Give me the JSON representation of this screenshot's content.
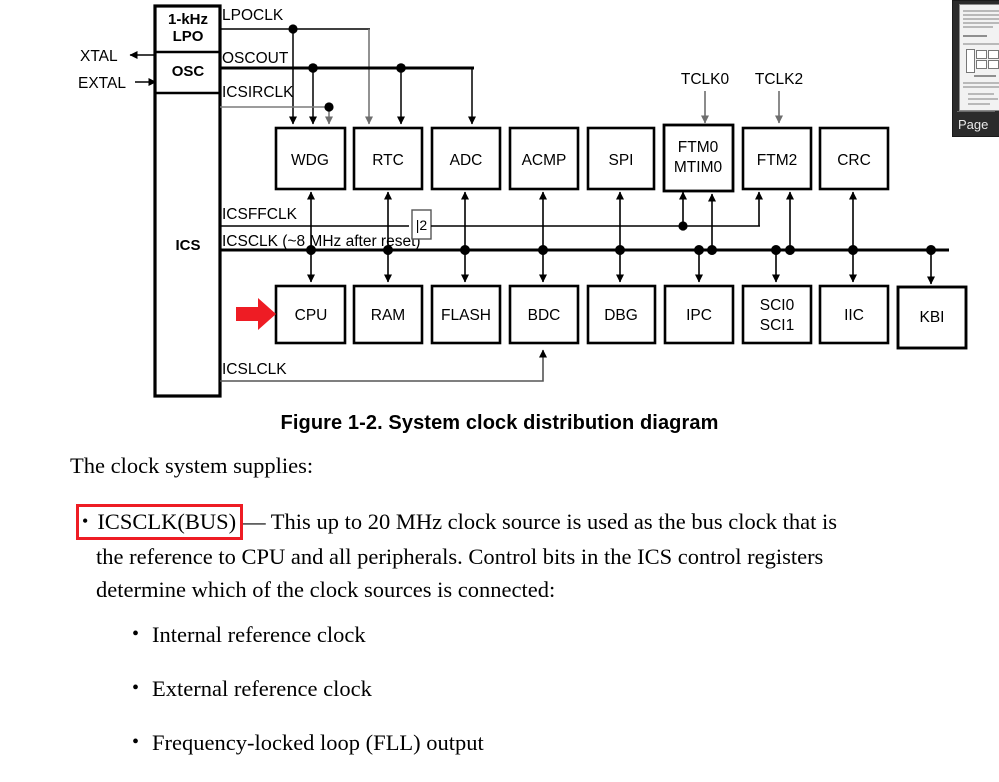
{
  "figure": {
    "caption": "Figure 1-2. System clock distribution diagram"
  },
  "diagram": {
    "left_block": {
      "lpo_label_line1": "1-kHz",
      "lpo_label_line2": "LPO",
      "osc_label": "OSC",
      "ics_label": "ICS"
    },
    "pins": {
      "xtal": "XTAL",
      "extal": "EXTAL"
    },
    "clock_signals": [
      "LPOCLK",
      "OSCOUT",
      "ICSIRCLK",
      "ICSFFCLK",
      "ICSCLK (~8 MHz after reset)",
      "ICSLCLK"
    ],
    "timer_inputs": [
      "TCLK0",
      "TCLK2"
    ],
    "divider_label": "|2",
    "top_row_blocks": [
      "WDG",
      "RTC",
      "ADC",
      "ACMP",
      "SPI",
      "FTM0\nMTIM0",
      "FTM2",
      "CRC"
    ],
    "bottom_row_blocks": [
      "CPU",
      "RAM",
      "FLASH",
      "BDC",
      "DBG",
      "IPC",
      "SCI0\nSCI1",
      "IIC",
      "KBI"
    ],
    "annotation": {
      "red_arrow_target": "CPU",
      "red_arrow_color": "#ee1c24"
    }
  },
  "text": {
    "lead": "The clock system supplies:",
    "bullet1": {
      "bullet_glyph": "•",
      "highlight": "ICSCLK(BUS)",
      "rest_line1": "— This up to 20 MHz clock source is used as the bus clock that is",
      "line2": "the reference to CPU and all peripherals. Control bits in the ICS control registers",
      "line3": "determine which of the clock sources is connected:"
    },
    "sub_bullets": [
      "Internal reference clock",
      "External reference clock",
      "Frequency-locked loop (FLL) output"
    ]
  },
  "thumbnail_panel": {
    "caption": "Page"
  },
  "colors": {
    "highlight_red": "#ee1c24",
    "wire_black": "#000000",
    "wire_gray": "#7b7b7b",
    "page_background": "#ffffff"
  }
}
